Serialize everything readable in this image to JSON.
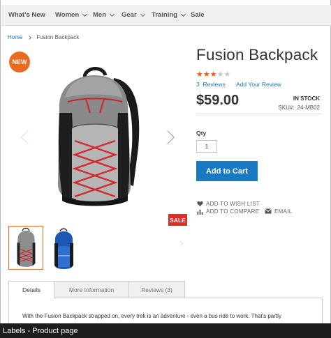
{
  "nav": {
    "items": [
      {
        "label": "What's New",
        "has_dropdown": false
      },
      {
        "label": "Women",
        "has_dropdown": true
      },
      {
        "label": "Men",
        "has_dropdown": true
      },
      {
        "label": "Gear",
        "has_dropdown": true
      },
      {
        "label": "Training",
        "has_dropdown": true
      },
      {
        "label": "Sale",
        "has_dropdown": false
      }
    ]
  },
  "breadcrumb": {
    "home": "Home",
    "current": "Fusion Backpack"
  },
  "gallery": {
    "new_badge": "NEW",
    "sale_badge": "SALE",
    "thumbnails": [
      "gray-backpack",
      "blue-backpack"
    ],
    "active_thumbnail": 0
  },
  "product": {
    "name": "Fusion Backpack",
    "rating_stars": 3,
    "rating_max": 5,
    "reviews_count": "3",
    "reviews_label": "Reviews",
    "add_review": "Add Your Review",
    "price": "$59.00",
    "stock": "IN STOCK",
    "sku_label": "SKU#:",
    "sku": "24-MB02",
    "qty_label": "Qty",
    "qty_value": "1",
    "add_to_cart": "Add to Cart",
    "wishlist": "ADD TO WISH LIST",
    "compare": "ADD TO COMPARE",
    "email": "EMAIL"
  },
  "tabs": {
    "details": "Details",
    "more_info": "More Information",
    "reviews": "Reviews (3)",
    "active": "details"
  },
  "description": "With the Fusion Backpack strapped on, every trek is an adventure - even a bus ride to work. That's partly",
  "label_bar": "Labels - Product page",
  "colors": {
    "accent_blue": "#1979c3",
    "new_badge": "#ea6a22",
    "sale_badge": "#e02b27",
    "star_filled": "#ff5501",
    "star_empty": "#c7c7c7"
  }
}
